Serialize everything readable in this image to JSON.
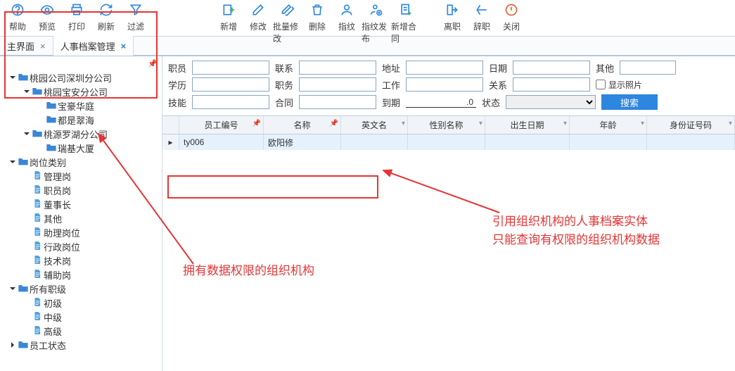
{
  "toolbar": [
    {
      "name": "help",
      "label": "帮助"
    },
    {
      "name": "preview",
      "label": "预览"
    },
    {
      "name": "print",
      "label": "打印"
    },
    {
      "name": "refresh",
      "label": "刷新"
    },
    {
      "name": "filter",
      "label": "过滤"
    },
    {
      "spacer": true,
      "big": true
    },
    {
      "name": "add",
      "label": "新增"
    },
    {
      "name": "edit",
      "label": "修改"
    },
    {
      "name": "batch-edit",
      "label": "批量修改"
    },
    {
      "name": "delete",
      "label": "删除"
    },
    {
      "name": "fingerprint",
      "label": "指纹"
    },
    {
      "name": "fp-publish",
      "label": "指纹发布"
    },
    {
      "name": "new-contract",
      "label": "新增合同"
    },
    {
      "spacer": true
    },
    {
      "name": "leave",
      "label": "离职"
    },
    {
      "name": "resign",
      "label": "辞职"
    },
    {
      "name": "close",
      "label": "关闭",
      "close": true
    }
  ],
  "tabs": [
    {
      "label": "主界面",
      "active": false
    },
    {
      "label": "人事档案管理",
      "active": true
    }
  ],
  "tree": [
    {
      "d": 0,
      "exp": "open",
      "ic": "folder-closed",
      "label": "桃园公司深圳分公司"
    },
    {
      "d": 1,
      "exp": "open",
      "ic": "folder-closed",
      "label": "桃园宝安分公司"
    },
    {
      "d": 2,
      "exp": "",
      "ic": "folder-closed",
      "label": "宝豪华庭"
    },
    {
      "d": 2,
      "exp": "",
      "ic": "folder-closed",
      "label": "都是翠海"
    },
    {
      "d": 1,
      "exp": "open",
      "ic": "folder-closed",
      "label": "桃源罗湖分公司"
    },
    {
      "d": 2,
      "exp": "",
      "ic": "folder-closed",
      "label": "瑞基大厦"
    },
    {
      "d": 0,
      "exp": "open",
      "ic": "folder-closed",
      "label": "岗位类别"
    },
    {
      "d": 1,
      "exp": "",
      "ic": "file",
      "label": "管理岗"
    },
    {
      "d": 1,
      "exp": "",
      "ic": "file",
      "label": "职员岗"
    },
    {
      "d": 1,
      "exp": "",
      "ic": "file",
      "label": "董事长"
    },
    {
      "d": 1,
      "exp": "",
      "ic": "file",
      "label": "其他"
    },
    {
      "d": 1,
      "exp": "",
      "ic": "file",
      "label": "助理岗位"
    },
    {
      "d": 1,
      "exp": "",
      "ic": "file",
      "label": "行政岗位"
    },
    {
      "d": 1,
      "exp": "",
      "ic": "file",
      "label": "技术岗"
    },
    {
      "d": 1,
      "exp": "",
      "ic": "file",
      "label": "辅助岗"
    },
    {
      "d": 0,
      "exp": "open",
      "ic": "folder-closed",
      "label": "所有职级"
    },
    {
      "d": 1,
      "exp": "",
      "ic": "file",
      "label": "初级"
    },
    {
      "d": 1,
      "exp": "",
      "ic": "file",
      "label": "中级"
    },
    {
      "d": 1,
      "exp": "",
      "ic": "file",
      "label": "高级"
    },
    {
      "d": 0,
      "exp": "closed",
      "ic": "folder-closed",
      "label": "员工状态"
    }
  ],
  "filters": {
    "row1": [
      {
        "label": "职员",
        "type": "text"
      },
      {
        "label": "联系",
        "type": "text"
      },
      {
        "label": "地址",
        "type": "text"
      },
      {
        "label": "日期",
        "type": "text"
      },
      {
        "label": "其他",
        "type": "text",
        "cls": "other"
      }
    ],
    "row2": [
      {
        "label": "学历",
        "type": "text"
      },
      {
        "label": "职务",
        "type": "text"
      },
      {
        "label": "工作",
        "type": "text"
      },
      {
        "label": "关系",
        "type": "text"
      }
    ],
    "row3": [
      {
        "label": "技能",
        "type": "text"
      },
      {
        "label": "合同",
        "type": "text"
      },
      {
        "label": "到期",
        "type": "daterange",
        "value": "0"
      },
      {
        "label": "状态",
        "type": "select"
      }
    ],
    "showPhoto": "显示照片",
    "search": "搜索"
  },
  "grid": {
    "columns": [
      {
        "label": "员工编号",
        "w": 120,
        "pin": true
      },
      {
        "label": "名称",
        "w": 110,
        "pin": true
      },
      {
        "label": "英文名",
        "w": 95
      },
      {
        "label": "性别名称",
        "w": 110
      },
      {
        "label": "出生日期",
        "w": 120
      },
      {
        "label": "年龄",
        "w": 110
      },
      {
        "label": "身份证号码",
        "w": 125
      }
    ],
    "rows": [
      {
        "cells": [
          "ty006",
          "欧阳修",
          "",
          "",
          "",
          "",
          ""
        ]
      }
    ]
  },
  "annotations": {
    "left": "拥有数据权限的组织机构",
    "right1": "引用组织机构的人事档案实体",
    "right2": "只能查询有权限的组织机构数据"
  }
}
